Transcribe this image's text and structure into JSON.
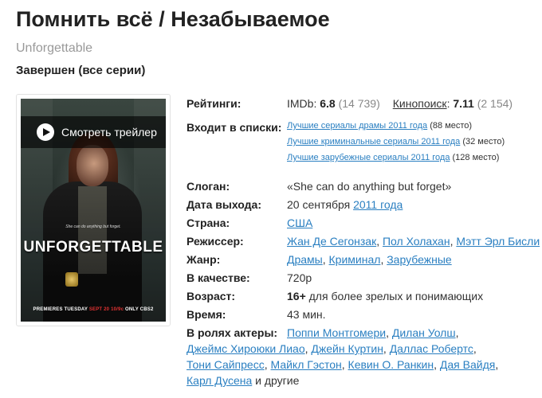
{
  "title": "Помнить всё / Незабываемое",
  "original_title": "Unforgettable",
  "status": "Завершен (все серии)",
  "poster": {
    "trailer_button": "Смотреть трейлер",
    "logo_text": "UNFORGETTABLE",
    "tagline": "She can do anything but forget.",
    "premiere_a": "PREMIERES TUESDAY",
    "premiere_b": "SEPT 20 10/9c",
    "premiere_c": "ONLY CBS",
    "premiere_d": "2"
  },
  "ratings": {
    "label": "Рейтинги:",
    "imdb_label": "IMDb:",
    "imdb_score": "6.8",
    "imdb_votes": "(14 739)",
    "kp_label": "Кинопоиск",
    "kp_colon": ":",
    "kp_score": "7.11",
    "kp_votes": "(2 154)"
  },
  "lists": {
    "label": "Входит в списки:",
    "items": [
      {
        "name": "Лучшие сериалы драмы 2011 года",
        "place": "(88 место)"
      },
      {
        "name": "Лучшие криминальные сериалы 2011 года",
        "place": "(32 место)"
      },
      {
        "name": "Лучшие зарубежные сериалы 2011 года",
        "place": "(128 место)"
      }
    ]
  },
  "slogan": {
    "label": "Слоган:",
    "value": "«She can do anything but forget»"
  },
  "release": {
    "label": "Дата выхода:",
    "date": "20 сентября",
    "year": "2011 года"
  },
  "country": {
    "label": "Страна:",
    "value": "США"
  },
  "director": {
    "label": "Режиссер:",
    "names": [
      "Жан Де Сегонзак",
      "Пол Холахан",
      "Мэтт Эрл Бисли"
    ]
  },
  "genre": {
    "label": "Жанр:",
    "names": [
      "Драмы",
      "Криминал",
      "Зарубежные"
    ]
  },
  "quality": {
    "label": "В качестве:",
    "value": "720p"
  },
  "age": {
    "label": "Возраст:",
    "rating": "16+",
    "text": "для более зрелых и понимающих"
  },
  "duration": {
    "label": "Время:",
    "value": "43 мин."
  },
  "cast": {
    "label": "В ролях актеры:",
    "names": [
      "Поппи Монтгомери",
      "Дилан Уолш",
      "Джеймс Хироюки Лиао",
      "Джейн Куртин",
      "Даллас Робертс",
      "Тони Сайпресс",
      "Майкл Гэстон",
      "Кевин О. Ранкин",
      "Дая Вайдя",
      "Карл Дусена"
    ],
    "more": "и другие"
  },
  "separator": ","
}
